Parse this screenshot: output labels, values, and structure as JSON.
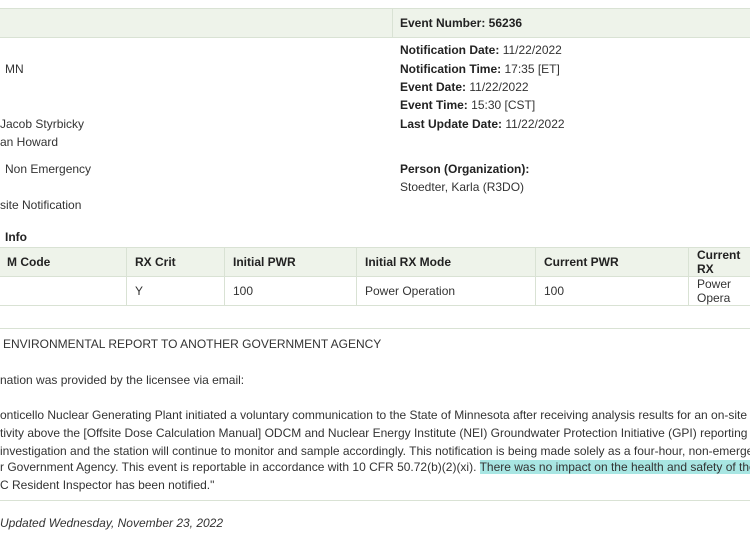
{
  "header": {
    "event_number": "Event Number: 56236"
  },
  "left_info": {
    "line1": "MN",
    "line2": "Jacob Styrbicky",
    "line3": "an Howard",
    "line4": "Non Emergency",
    "line5": "site Notification"
  },
  "right_info": {
    "notification_date_label": "Notification Date:",
    "notification_date": "11/22/2022",
    "notification_time_label": "Notification Time:",
    "notification_time": "17:35 [ET]",
    "event_date_label": "Event Date:",
    "event_date": "11/22/2022",
    "event_time_label": "Event Time:",
    "event_time": "15:30 [CST]",
    "last_update_label": "Last Update Date:",
    "last_update": "11/22/2022",
    "person_label": "Person (Organization):",
    "person_value": "Stoedter, Karla (R3DO)"
  },
  "section_title": "Info",
  "rx_table": {
    "headers": [
      "M Code",
      "RX Crit",
      "Initial PWR",
      "Initial RX Mode",
      "Current PWR",
      "Current RX"
    ],
    "row": [
      "",
      "Y",
      "100",
      "Power Operation",
      "100",
      "Power Opera"
    ]
  },
  "report": {
    "title": "ENVIRONMENTAL REPORT TO ANOTHER GOVERNMENT AGENCY",
    "intro": "nation was provided by the licensee via email:",
    "p1": "onticello Nuclear Generating Plant initiated a voluntary communication to the State of Minnesota after receiving analysis results for an on-site m",
    "p2": "tivity above the [Offsite Dose Calculation Manual] ODCM and Nuclear Energy Institute (NEI) Groundwater Protection Initiative (GPI) reporting lev",
    "p3": "investigation and the station will continue to monitor and sample accordingly. This notification is being made solely as a four-hour, non-emerger",
    "p4_a": "r Government Agency. This event is reportable in accordance with 10 CFR 50.72(b)(2)(xi). ",
    "p4_b": "There was no impact on the health and safety of the p",
    "p5": "C Resident Inspector has been notified.\""
  },
  "footer": {
    "updated": "Updated Wednesday, November 23, 2022"
  },
  "colors": {
    "header_band": "#eef3ea",
    "border": "#d9e2d4",
    "highlight": "#a8e6e3"
  }
}
